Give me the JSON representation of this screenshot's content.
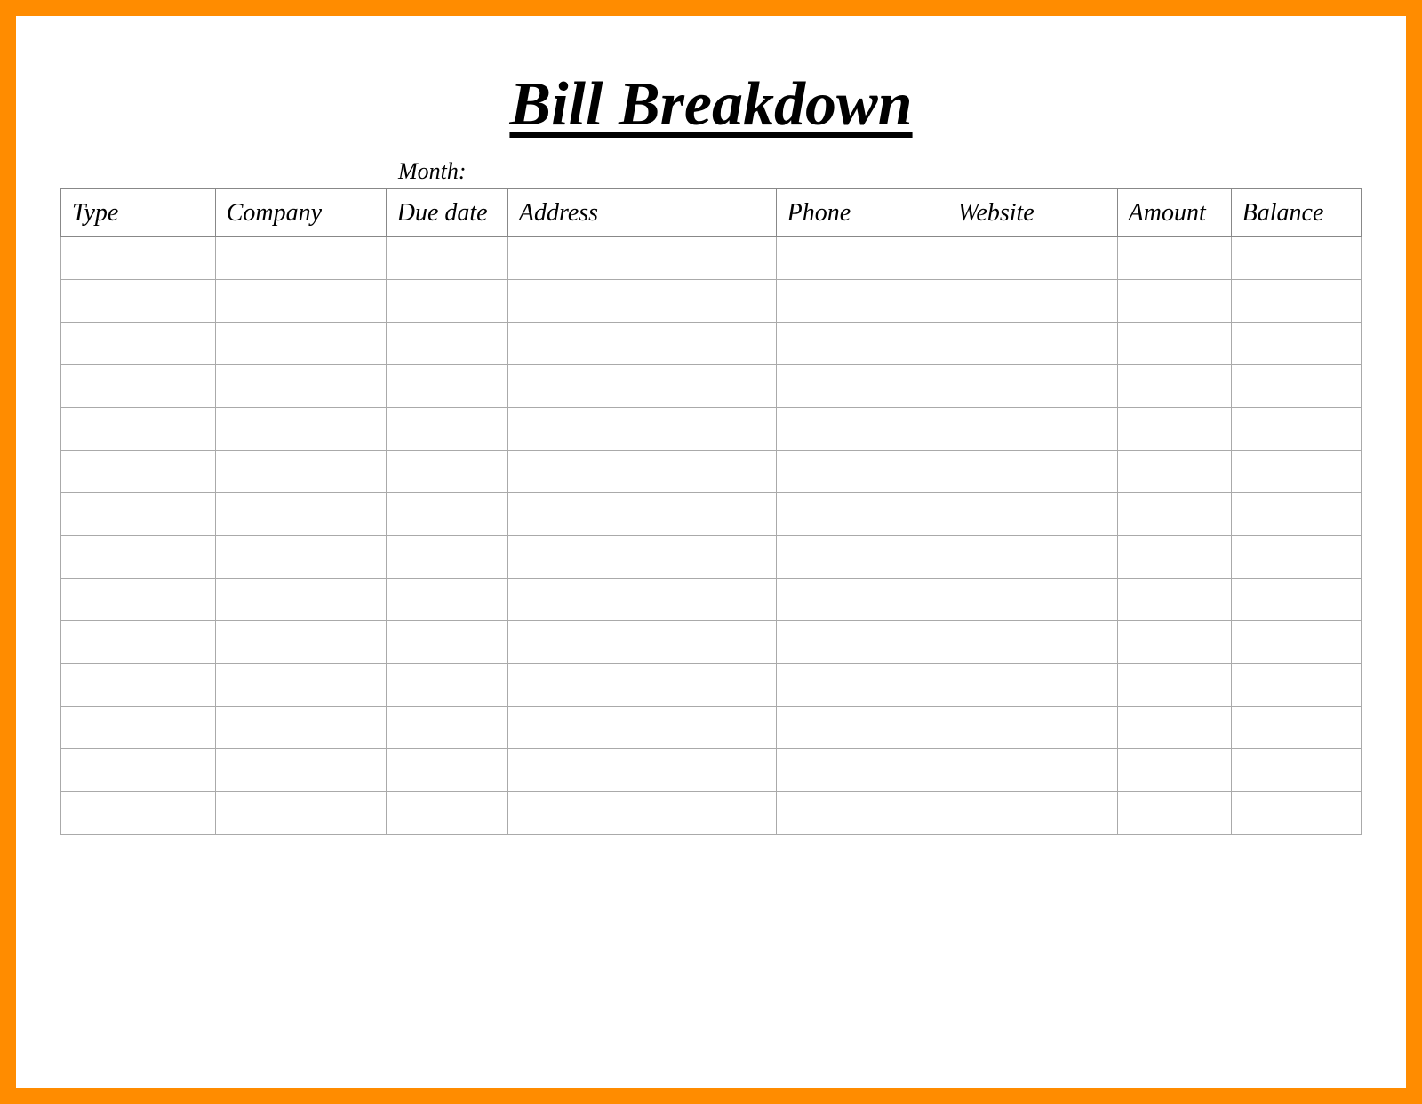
{
  "title": "Bill Breakdown",
  "month_label": "Month:",
  "columns": [
    "Type",
    "Company",
    "Due date",
    "Address",
    "Phone",
    "Website",
    "Amount",
    "Balance"
  ],
  "rows": [
    [
      "",
      "",
      "",
      "",
      "",
      "",
      "",
      ""
    ],
    [
      "",
      "",
      "",
      "",
      "",
      "",
      "",
      ""
    ],
    [
      "",
      "",
      "",
      "",
      "",
      "",
      "",
      ""
    ],
    [
      "",
      "",
      "",
      "",
      "",
      "",
      "",
      ""
    ],
    [
      "",
      "",
      "",
      "",
      "",
      "",
      "",
      ""
    ],
    [
      "",
      "",
      "",
      "",
      "",
      "",
      "",
      ""
    ],
    [
      "",
      "",
      "",
      "",
      "",
      "",
      "",
      ""
    ],
    [
      "",
      "",
      "",
      "",
      "",
      "",
      "",
      ""
    ],
    [
      "",
      "",
      "",
      "",
      "",
      "",
      "",
      ""
    ],
    [
      "",
      "",
      "",
      "",
      "",
      "",
      "",
      ""
    ],
    [
      "",
      "",
      "",
      "",
      "",
      "",
      "",
      ""
    ],
    [
      "",
      "",
      "",
      "",
      "",
      "",
      "",
      ""
    ],
    [
      "",
      "",
      "",
      "",
      "",
      "",
      "",
      ""
    ],
    [
      "",
      "",
      "",
      "",
      "",
      "",
      "",
      ""
    ]
  ]
}
